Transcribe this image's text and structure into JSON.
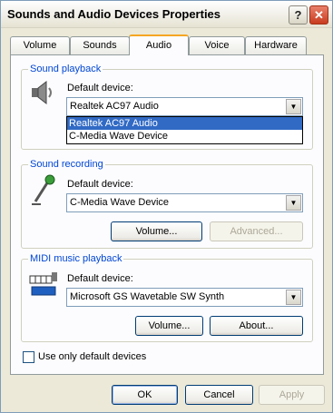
{
  "window": {
    "title": "Sounds and Audio Devices Properties",
    "help_glyph": "?",
    "close_glyph": "✕"
  },
  "tabs": [
    {
      "label": "Volume"
    },
    {
      "label": "Sounds"
    },
    {
      "label": "Audio"
    },
    {
      "label": "Voice"
    },
    {
      "label": "Hardware"
    }
  ],
  "active_tab": "Audio",
  "sound_playback": {
    "group_label": "Sound playback",
    "default_device_label": "Default device:",
    "selected_value": "Realtek AC97 Audio",
    "dropdown_options": [
      "Realtek AC97 Audio",
      "C-Media Wave Device"
    ],
    "highlighted_option": "Realtek AC97 Audio"
  },
  "sound_recording": {
    "group_label": "Sound recording",
    "default_device_label": "Default device:",
    "selected_value": "C-Media Wave Device",
    "volume_button": "Volume...",
    "advanced_button": "Advanced..."
  },
  "midi_playback": {
    "group_label": "MIDI music playback",
    "default_device_label": "Default device:",
    "selected_value": "Microsoft GS Wavetable SW Synth",
    "volume_button": "Volume...",
    "about_button": "About..."
  },
  "use_only_default": {
    "label": "Use only default devices",
    "checked": false
  },
  "footer": {
    "ok": "OK",
    "cancel": "Cancel",
    "apply": "Apply"
  },
  "colors": {
    "group_label": "#0046d5",
    "tab_highlight": "#f5a623",
    "selection": "#316ac5"
  }
}
